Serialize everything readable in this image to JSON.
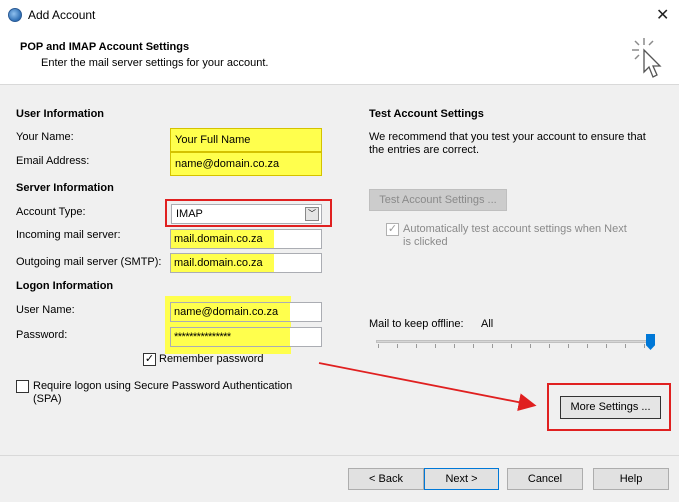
{
  "window": {
    "title": "Add Account"
  },
  "header": {
    "title": "POP and IMAP Account Settings",
    "subtitle": "Enter the mail server settings for your account."
  },
  "user_info": {
    "heading": "User Information",
    "name_label": "Your Name:",
    "name_value": "Your Full Name",
    "email_label": "Email Address:",
    "email_value": "name@domain.co.za"
  },
  "server_info": {
    "heading": "Server Information",
    "account_type_label": "Account Type:",
    "account_type_value": "IMAP",
    "incoming_label": "Incoming mail server:",
    "incoming_value": "mail.domain.co.za",
    "outgoing_label": "Outgoing mail server (SMTP):",
    "outgoing_value": "mail.domain.co.za"
  },
  "logon_info": {
    "heading": "Logon Information",
    "username_label": "User Name:",
    "username_value": "name@domain.co.za",
    "password_label": "Password:",
    "password_value": "***************",
    "remember_label": "Remember password",
    "remember_checked": true,
    "spa_label_line1": "Require logon using Secure Password Authentication",
    "spa_label_line2": "(SPA)"
  },
  "test_settings": {
    "heading": "Test Account Settings",
    "desc_line1": "We recommend that you test your account to ensure that",
    "desc_line2": "the entries are correct.",
    "test_button": "Test Account Settings ...",
    "auto_test_line1": "Automatically test account settings when Next",
    "auto_test_line2": "is clicked"
  },
  "offline": {
    "label": "Mail to keep offline:",
    "value": "All"
  },
  "buttons": {
    "more_settings": "More Settings ...",
    "back": "< Back",
    "next": "Next >",
    "cancel": "Cancel",
    "help": "Help"
  },
  "colors": {
    "highlight": "#ffff4d",
    "annotation_red": "#e02020",
    "accent": "#0078d7"
  }
}
